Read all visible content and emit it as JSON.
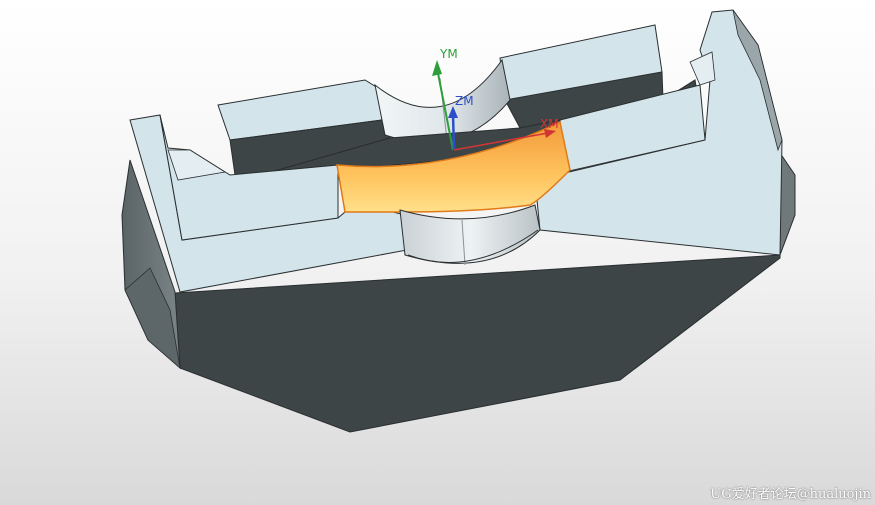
{
  "viewport": {
    "background_top": "#ffffff",
    "background_bottom": "#d9d9d9"
  },
  "model": {
    "colors": {
      "top_face": "#d3e4ea",
      "dark_face": "#3d4547",
      "side_face": "#6f787a",
      "cylinder_light": "#e9eef0",
      "cylinder_mid": "#c7cfd3",
      "highlight_face": "#f5a94a",
      "highlight_light": "#ffd37a",
      "edge": "#2a2f31"
    }
  },
  "csys": {
    "y_label": "YM",
    "z_label": "ZM",
    "x_label": "XM",
    "y_color": "#2e9e3a",
    "z_color": "#2b4fc9",
    "x_color": "#d23535"
  },
  "watermark": {
    "text": "UG爱好者论坛@hualuojin"
  }
}
